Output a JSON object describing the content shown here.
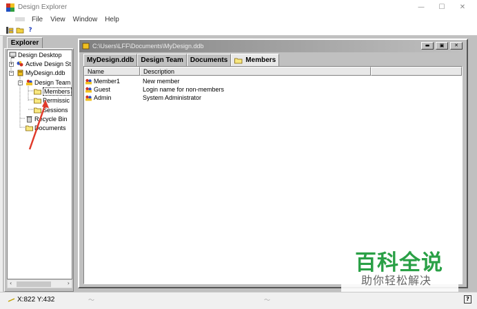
{
  "window": {
    "title": "Design Explorer",
    "controls": [
      "—",
      "☐",
      "✕"
    ]
  },
  "menu": [
    "File",
    "View",
    "Window",
    "Help"
  ],
  "toolbar": {
    "buttons": [
      "open-tree-icon",
      "open-folder-icon",
      "help-icon"
    ],
    "help_glyph": "?"
  },
  "explorer": {
    "tab_label": "Explorer",
    "tree": [
      {
        "label": "Design Desktop",
        "icon": "desktop-icon"
      },
      {
        "label": "Active Design St",
        "icon": "network-icon"
      },
      {
        "label": "MyDesign.ddb",
        "icon": "database-icon"
      },
      {
        "label": "Design Team",
        "icon": "team-icon"
      },
      {
        "label": "Members",
        "icon": "folder-icon"
      },
      {
        "label": "Permissic",
        "icon": "folder-icon"
      },
      {
        "label": "Sessions",
        "icon": "folder-icon"
      },
      {
        "label": "Recycle Bin",
        "icon": "recycle-bin-icon"
      },
      {
        "label": "Documents",
        "icon": "folder-icon"
      }
    ],
    "expanders": [
      "+",
      "−",
      "−"
    ],
    "scroll_left": "‹",
    "scroll_right": "›"
  },
  "document": {
    "path": "C:\\Users\\LFF\\Documents\\MyDesign.ddb",
    "tabs": [
      "MyDesign.ddb",
      "Design Team",
      "Documents",
      "Members"
    ],
    "active_tab": "Members",
    "columns": [
      "Name",
      "Description"
    ],
    "rows": [
      {
        "name": "Member1",
        "description": "New member"
      },
      {
        "name": "Guest",
        "description": "Login name for non-members"
      },
      {
        "name": "Admin",
        "description": "System Administrator"
      }
    ]
  },
  "statusbar": {
    "coords": "X:822 Y:432",
    "help_glyph": "?"
  },
  "watermark": {
    "main": "百科全说",
    "sub": "助你轻松解决"
  },
  "colors": {
    "workspace": "#c0c0c0",
    "mdi_title_start": "#808080",
    "mdi_title_end": "#c0c0c0",
    "watermark_green": "#2aa046",
    "annotation_red": "#e03a2a"
  }
}
